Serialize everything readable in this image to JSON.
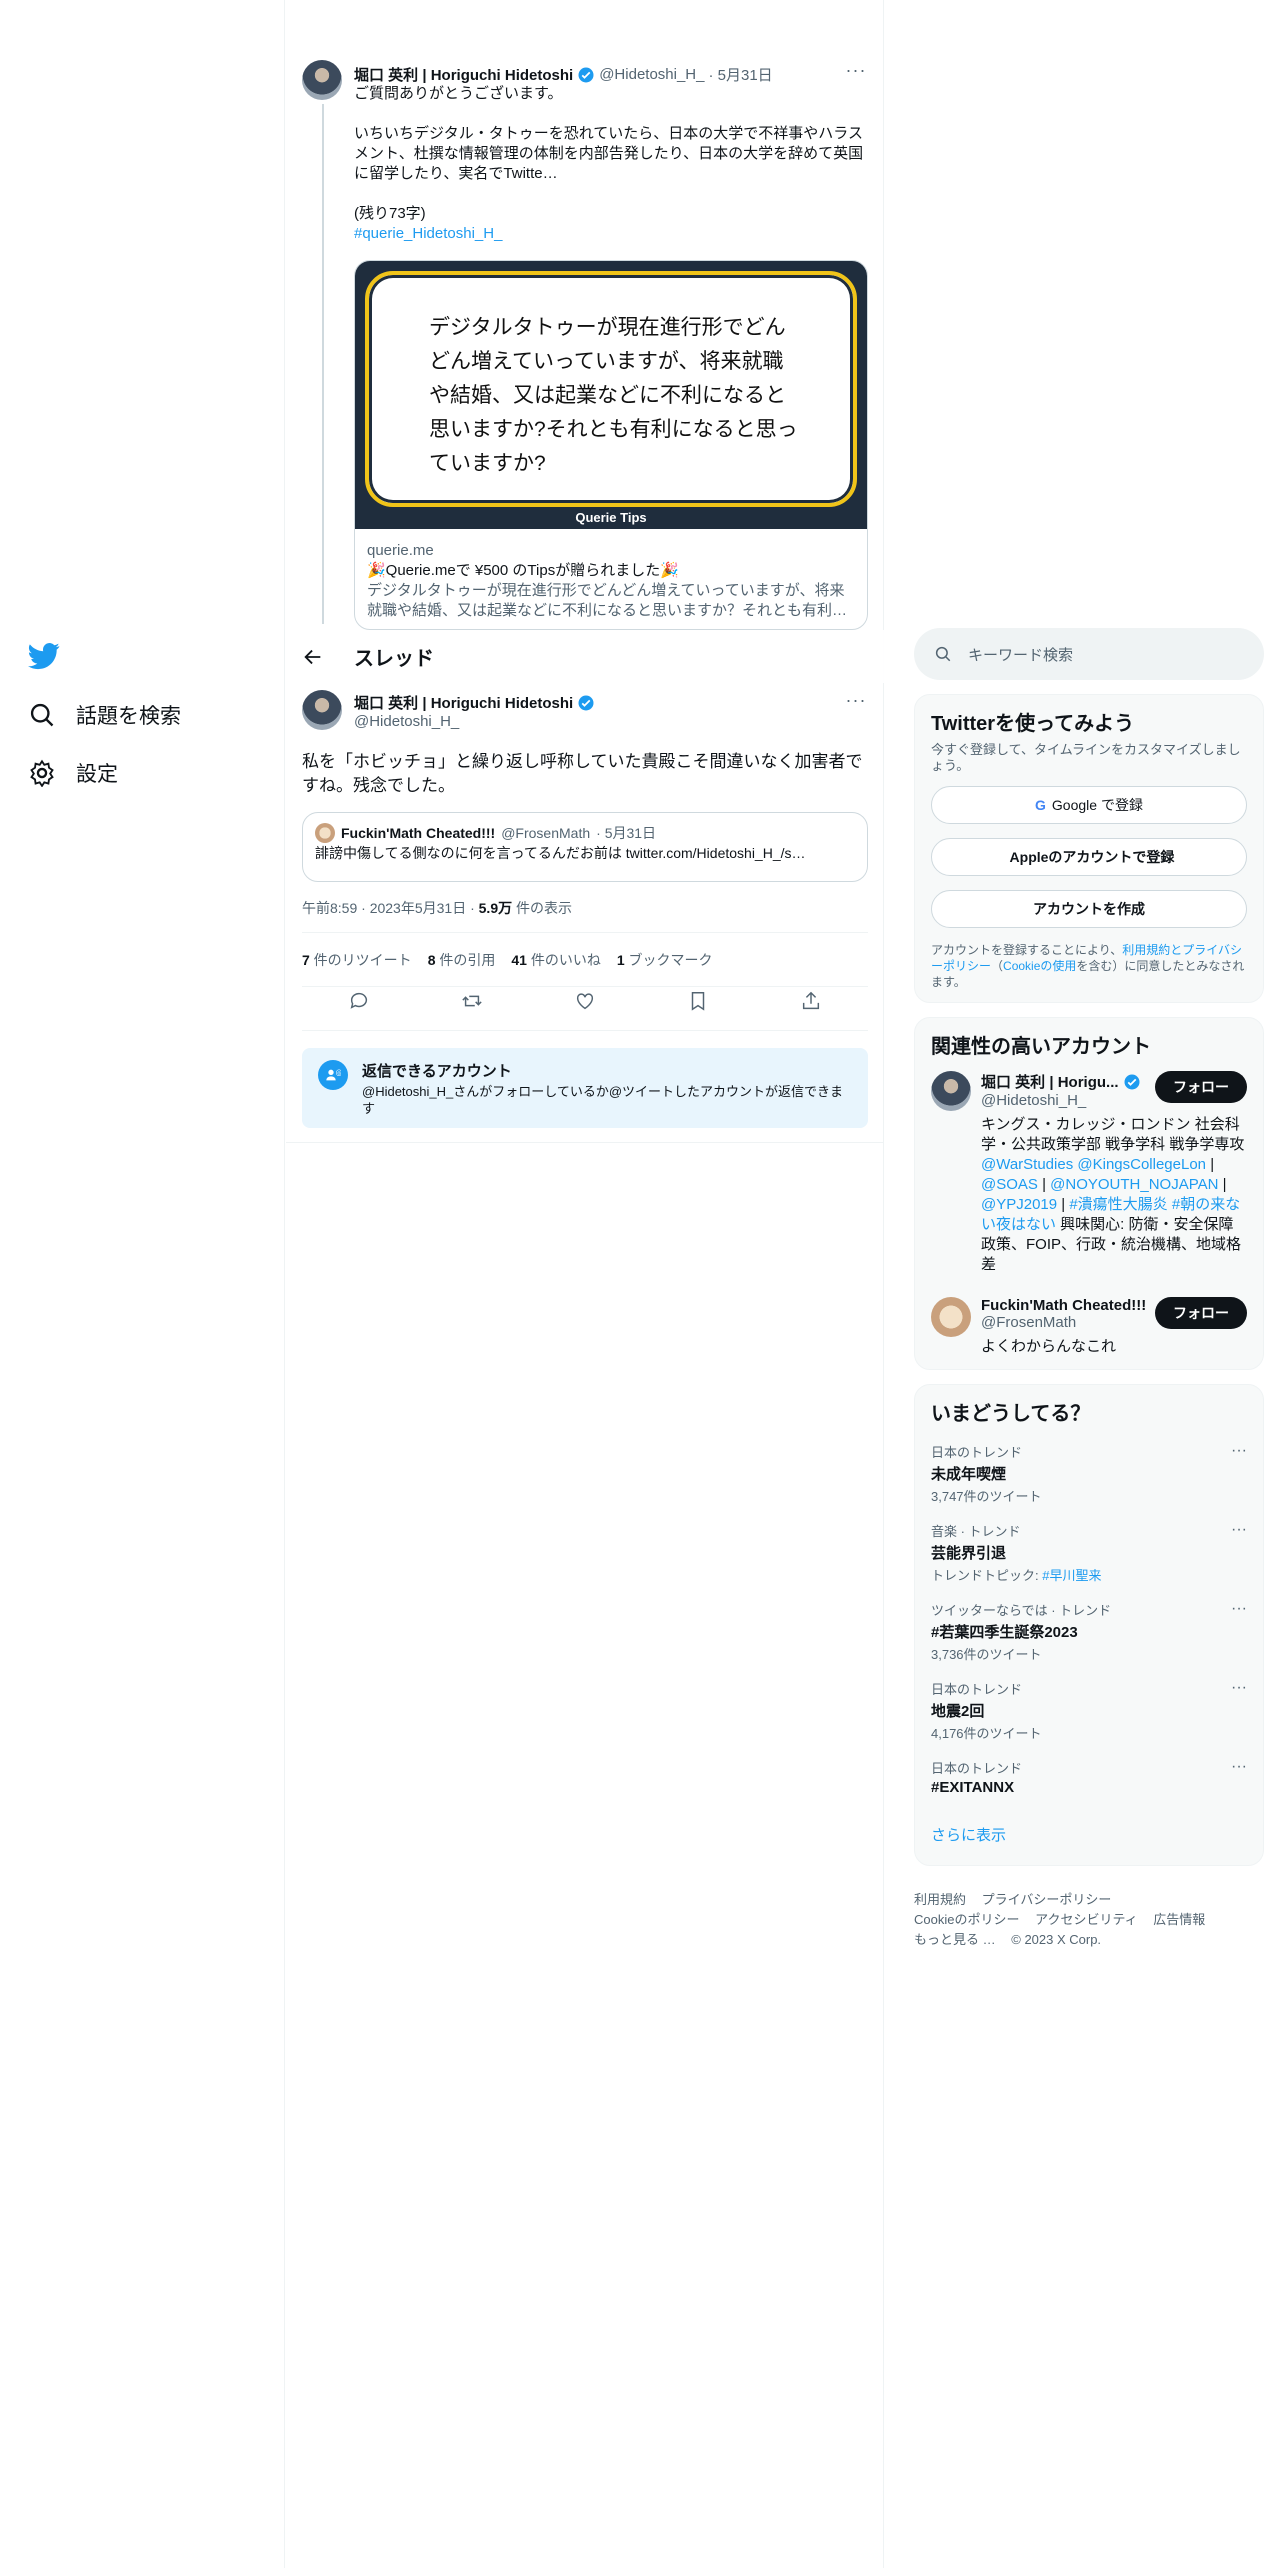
{
  "nav": {
    "explore": "話題を検索",
    "settings": "設定"
  },
  "prev_tweet": {
    "name": "堀口 英利 | Horiguchi Hidetoshi",
    "handle": "@Hidetoshi_H_",
    "date": "· 5月31日",
    "line1": "ご質問ありがとうございます。",
    "line2": "いちいちデジタル・タトゥーを恐れていたら、日本の大学で不祥事やハラスメント、杜撰な情報管理の体制を内部告発したり、日本の大学を辞めて英国に留学したり、実名でTwitte…",
    "line3": "(残り73字)",
    "hashtag": "#querie_Hidetoshi_H_",
    "card_question": "デジタルタトゥーが現在進行形でどんどん増えていっていますが、将来就職や結婚、又は起業などに不利になると思いますか?それとも有利になると思っていますか?",
    "card_brand": "Querie Tips",
    "card_domain": "querie.me",
    "card_title": "🎉Querie.meで ¥500 のTipsが贈られました🎉",
    "card_desc": "デジタルタトゥーが現在進行形でどんどん増えていっていますが、将来就職や結婚、又は起業などに不利になると思いますか？それとも有利…"
  },
  "header": {
    "title": "スレッド"
  },
  "main_tweet": {
    "name": "堀口 英利 | Horiguchi Hidetoshi",
    "handle": "@Hidetoshi_H_",
    "text": "私を「ホビッチョ」と繰り返し呼称していた貴殿こそ間違いなく加害者ですね。残念でした。",
    "quote_name": "Fuckin'Math Cheated!!!",
    "quote_handle": "@FrosenMath",
    "quote_date": "· 5月31日",
    "quote_text": "誹謗中傷してる側なのに何を言ってるんだお前は twitter.com/Hidetoshi_H_/s…",
    "time": "午前8:59 · 2023年5月31日 · ",
    "views_num": "5.9万",
    "views_label": " 件の表示",
    "retweets": "7",
    "retweets_label": " 件のリツイート",
    "quotes": "8",
    "quotes_label": " 件の引用",
    "likes": "41",
    "likes_label": " 件のいいね",
    "bookmarks": "1",
    "bookmarks_label": " ブックマーク",
    "reply_title": "返信できるアカウント",
    "reply_desc": "@Hidetoshi_H_さんがフォローしているか@ツイートしたアカウントが返信できます"
  },
  "right": {
    "search_placeholder": "キーワード検索",
    "signup_title": "Twitterを使ってみよう",
    "signup_sub": "今すぐ登録して、タイムラインをカスタマイズしましょう。",
    "google": "Google で登録",
    "apple": "Appleのアカウントで登録",
    "create": "アカウントを作成",
    "fine_a": "アカウントを登録することにより、",
    "fine_link1": "利用規約とプライバシーポリシー",
    "fine_b": "（",
    "fine_link2": "Cookieの使用",
    "fine_c": "を含む）に同意したとみなされます。",
    "related_title": "関連性の高いアカウント",
    "rel1_name": "堀口 英利 | Horigu...",
    "rel1_handle": "@Hidetoshi_H_",
    "rel1_bio_1": "キングス・カレッジ・ロンドン 社会科学・公共政策学部 戦争学科 戦争学専攻 ",
    "rel1_bio_l1": "@WarStudies",
    "rel1_bio_l2": "@KingsCollegeLon",
    "rel1_bio_l3": "@SOAS",
    "rel1_bio_l4": "@NOYOUTH_NOJAPAN",
    "rel1_bio_l5": "@YPJ2019",
    "rel1_bio_l6": "#潰瘍性大腸炎",
    "rel1_bio_l7": "#朝の来ない夜はない",
    "rel1_bio_2": " 興味関心: 防衛・安全保障政策、FOIP、行政・統治機構、地域格差",
    "rel2_name": "Fuckin'Math Cheated!!!",
    "rel2_handle": "@FrosenMath",
    "rel2_bio": "よくわからんなこれ",
    "follow": "フォロー",
    "trends_title": "いまどうしてる？",
    "trends": [
      {
        "ctx": "日本のトレンド",
        "title": "未成年喫煙",
        "count": "3,747件のツイート"
      },
      {
        "ctx": "音楽 · トレンド",
        "title": "芸能界引退",
        "count": "トレンドトピック: ",
        "link": "#早川聖来"
      },
      {
        "ctx": "ツイッターならでは · トレンド",
        "title": "#若葉四季生誕祭2023",
        "count": "3,736件のツイート"
      },
      {
        "ctx": "日本のトレンド",
        "title": "地震2回",
        "count": "4,176件のツイート"
      },
      {
        "ctx": "日本のトレンド",
        "title": "#EXITANNX",
        "count": ""
      }
    ],
    "show_more": "さらに表示",
    "footer_1": "利用規約",
    "footer_2": "プライバシーポリシー",
    "footer_3": "Cookieのポリシー",
    "footer_4": "アクセシビリティ",
    "footer_5": "広告情報",
    "footer_6": "もっと見る …",
    "footer_7": "© 2023 X Corp."
  },
  "colors": {
    "accent": "#1d9bf0",
    "text": "#0f1419",
    "muted": "#536471"
  }
}
